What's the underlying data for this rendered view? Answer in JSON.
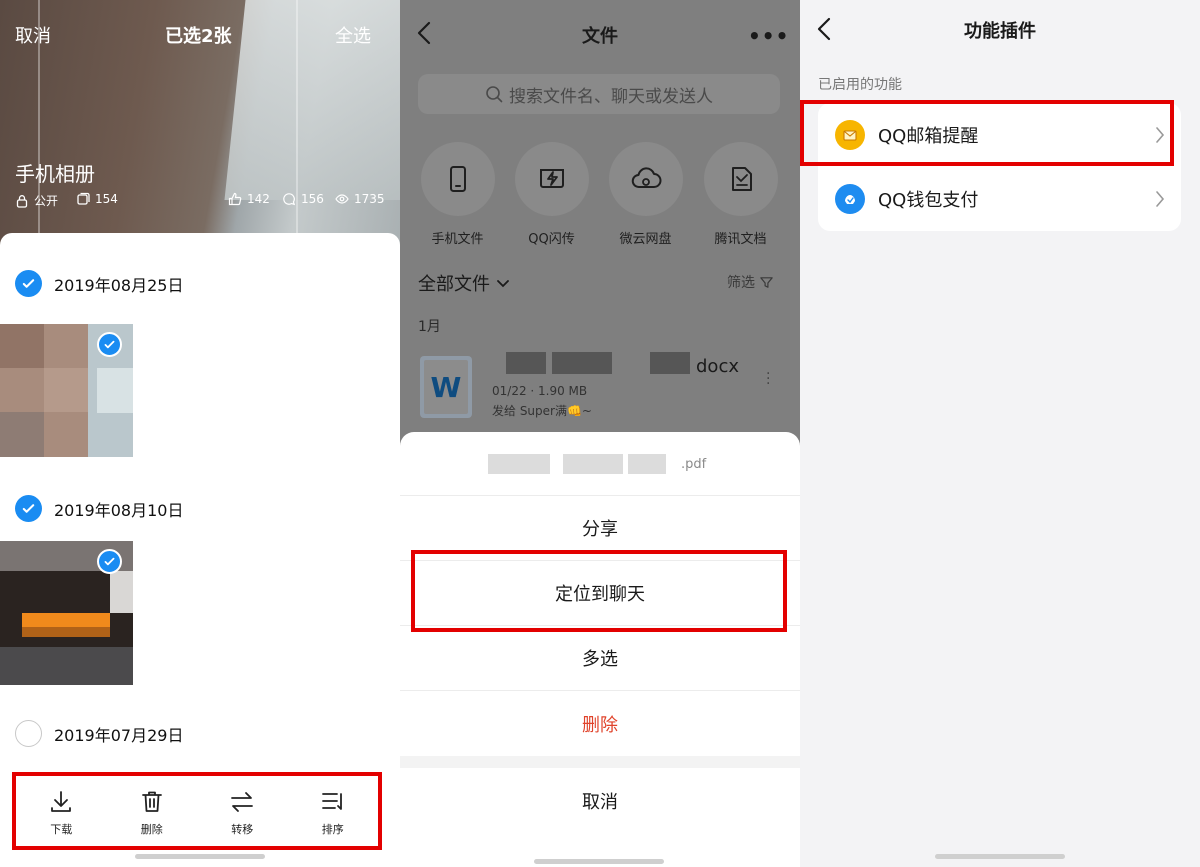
{
  "panel1": {
    "top_bar": {
      "cancel": "取消",
      "title": "已选2张",
      "select_all": "全选"
    },
    "album": {
      "name": "手机相册",
      "visibility": "公开",
      "photo_count": "154",
      "likes": "142",
      "comments": "156",
      "views": "1735"
    },
    "groups": [
      {
        "date": "2019年08月25日",
        "checked": true
      },
      {
        "date": "2019年08月10日",
        "checked": true
      },
      {
        "date": "2019年07月29日",
        "checked": false
      }
    ],
    "toolbar": [
      {
        "label": "下载",
        "icon": "download-icon"
      },
      {
        "label": "删除",
        "icon": "trash-icon"
      },
      {
        "label": "转移",
        "icon": "transfer-icon"
      },
      {
        "label": "排序",
        "icon": "sort-icon"
      }
    ],
    "highlight_color": "#e30000",
    "accent": "#1a8cf2"
  },
  "panel2": {
    "title": "文件",
    "more": "•••",
    "search_placeholder": "搜索文件名、聊天或发送人",
    "quick_access": [
      {
        "label": "手机文件",
        "icon": "phone-icon"
      },
      {
        "label": "QQ闪传",
        "icon": "flash-transfer-icon"
      },
      {
        "label": "微云网盘",
        "icon": "cloud-icon"
      },
      {
        "label": "腾讯文档",
        "icon": "docs-icon"
      }
    ],
    "all_files": "全部文件",
    "filter": "筛选",
    "month": "1月",
    "file": {
      "ext": "docx",
      "info": "01/22 · 1.90 MB",
      "sender": "发给 Super满👊~",
      "icon_letter": "W"
    },
    "sheet": {
      "file_ext": ".pdf",
      "actions": [
        "分享",
        "定位到聊天",
        "多选",
        "删除"
      ],
      "cancel": "取消"
    }
  },
  "panel3": {
    "title": "功能插件",
    "section": "已启用的功能",
    "items": [
      {
        "label": "QQ邮箱提醒",
        "icon": "mail-icon"
      },
      {
        "label": "QQ钱包支付",
        "icon": "wallet-icon"
      }
    ]
  }
}
